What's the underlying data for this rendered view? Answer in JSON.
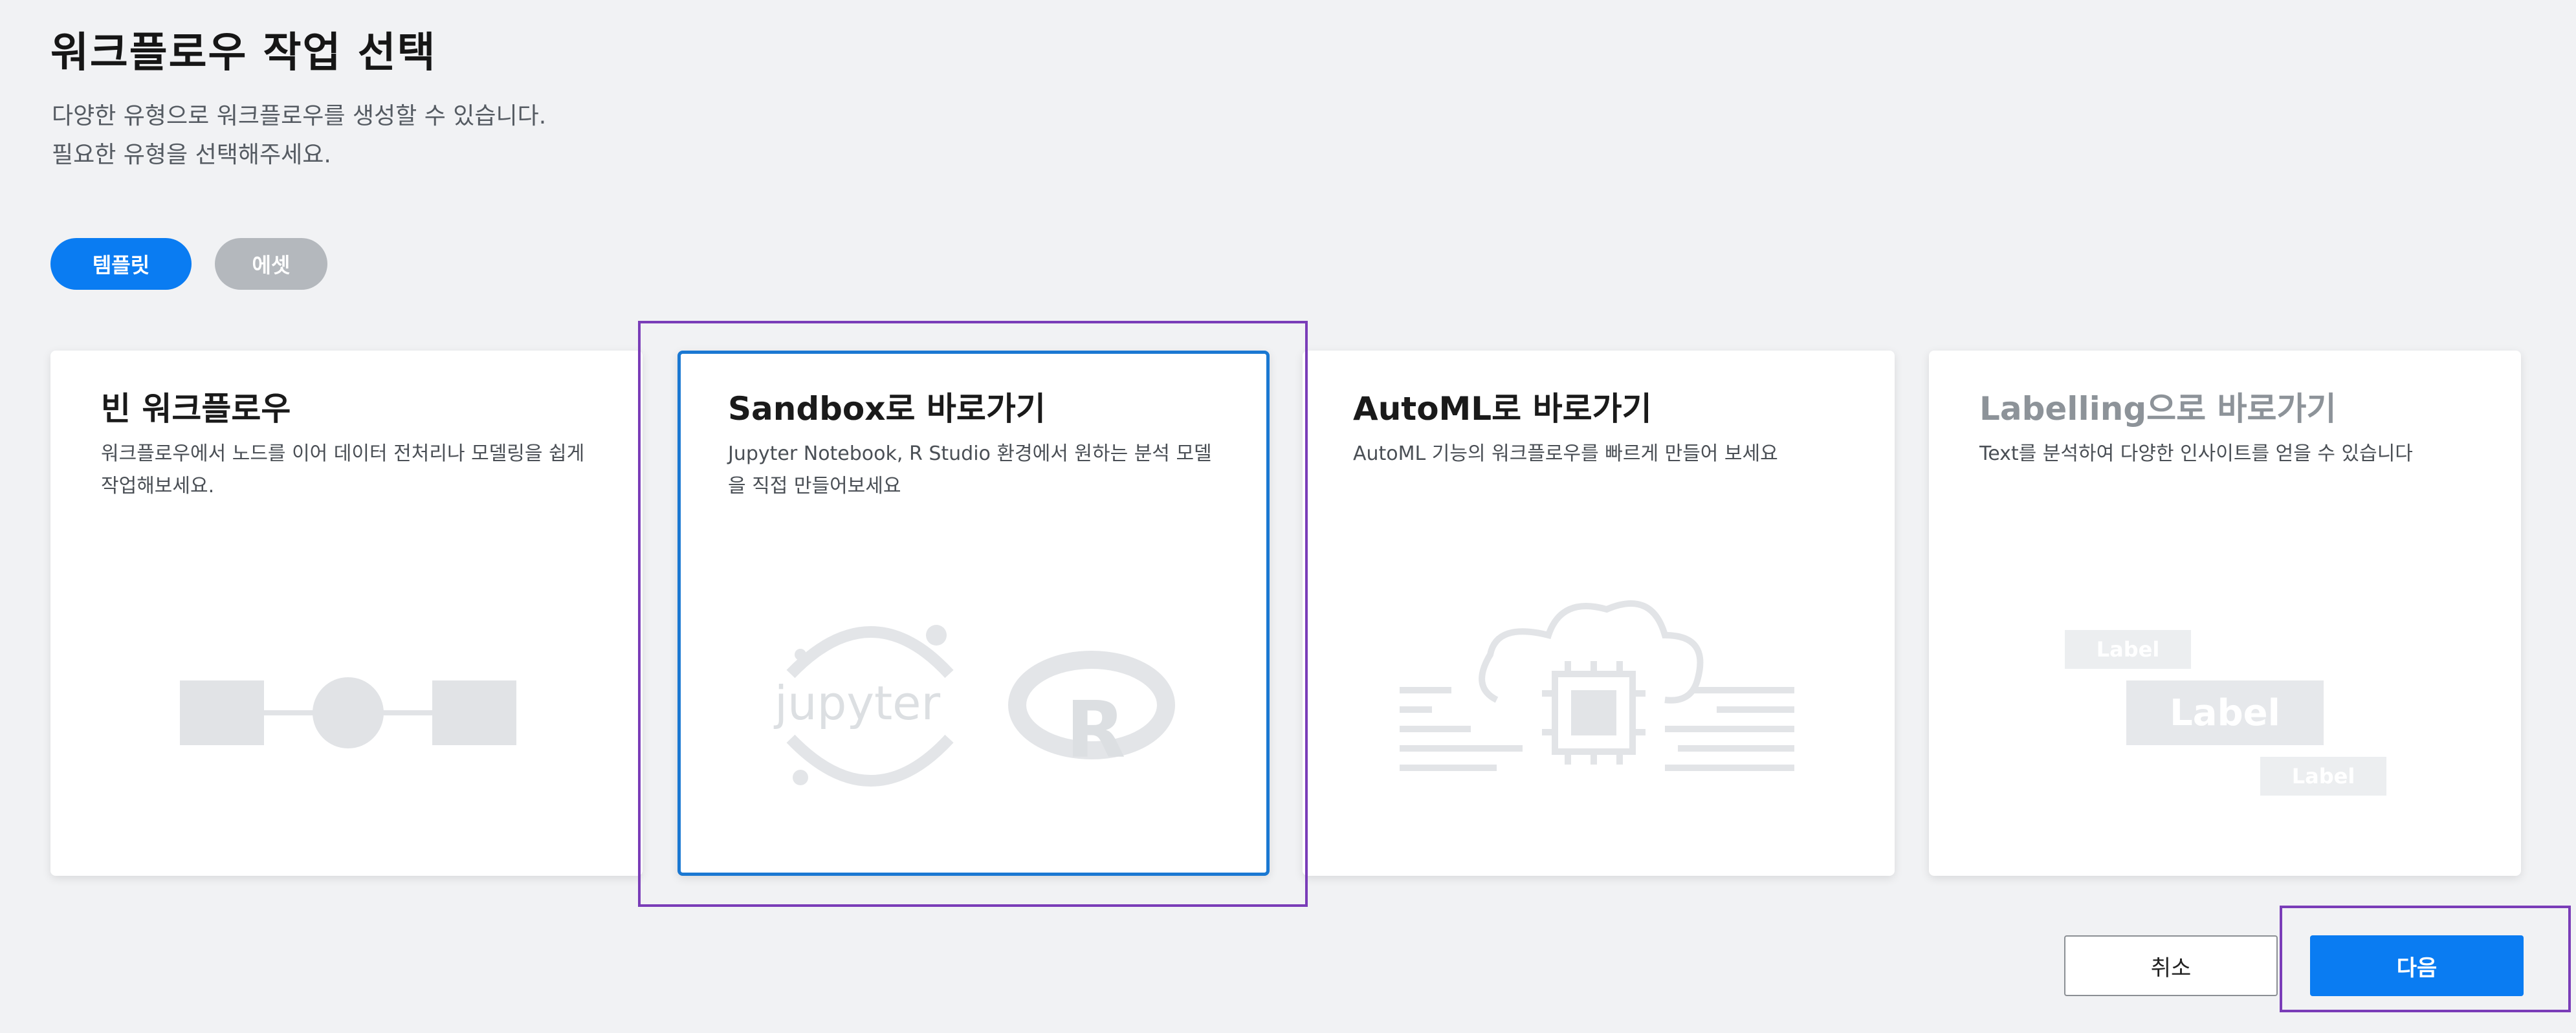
{
  "header": {
    "title": "워크플로우 작업 선택",
    "desc_line1": "다양한 유형으로 워크플로우를 생성할 수 있습니다.",
    "desc_line2": "필요한 유형을 선택해주세요."
  },
  "tabs": [
    {
      "label": "템플릿",
      "active": true
    },
    {
      "label": "에셋",
      "active": false
    }
  ],
  "cards": [
    {
      "title": "빈 워크플로우",
      "desc": "워크플로우에서 노드를 이어 데이터 전처리나 모델링을 쉽게 작업해보세요.",
      "icon": "node-flow-icon"
    },
    {
      "title": "Sandbox로 바로가기",
      "desc": "Jupyter Notebook, R Studio 환경에서 원하는 분석 모델을 직접 만들어보세요",
      "icon": "jupyter-r-icon",
      "jupyter_text": "jupyter",
      "r_text": "R",
      "selected": true
    },
    {
      "title": "AutoML로 바로가기",
      "desc": "AutoML 기능의 워크플로우를 빠르게 만들어 보세요",
      "icon": "cloud-chip-icon"
    },
    {
      "title": "Labelling으로 바로가기",
      "desc": "Text를 분석하여 다양한 인사이트를 얻을 수 있습니다",
      "icon": "label-tags-icon",
      "labels": [
        "Label",
        "Label",
        "Label"
      ],
      "disabled": true
    }
  ],
  "footer": {
    "cancel_label": "취소",
    "next_label": "다음"
  },
  "colors": {
    "primary": "#0a7cf2",
    "inactive_pill": "#b4b8bd",
    "highlight": "#7a3db8",
    "selected_border": "#1a78d2"
  }
}
